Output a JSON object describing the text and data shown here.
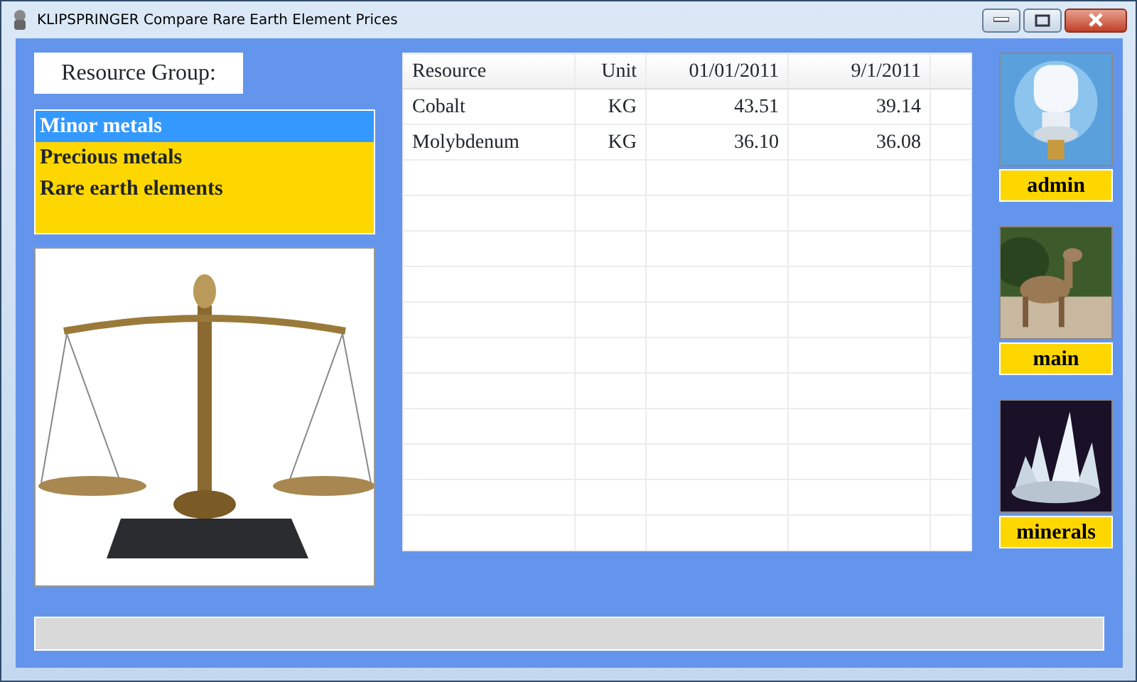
{
  "window": {
    "title": "KLIPSPRINGER Compare Rare Earth Element Prices"
  },
  "resource_group": {
    "label": "Resource Group:"
  },
  "groups": [
    {
      "label": "Minor metals",
      "selected": true
    },
    {
      "label": "Precious metals",
      "selected": false
    },
    {
      "label": "Rare earth elements",
      "selected": false
    }
  ],
  "table": {
    "columns": [
      "Resource",
      "Unit",
      "01/01/2011",
      "9/1/2011"
    ],
    "rows": [
      [
        "Cobalt",
        "KG",
        "43.51",
        "39.14"
      ],
      [
        "Molybdenum",
        "KG",
        "36.10",
        "36.08"
      ]
    ]
  },
  "tiles": [
    {
      "label": "admin",
      "kind": "bulb"
    },
    {
      "label": "main",
      "kind": "antelope"
    },
    {
      "label": "minerals",
      "kind": "crystal"
    }
  ]
}
